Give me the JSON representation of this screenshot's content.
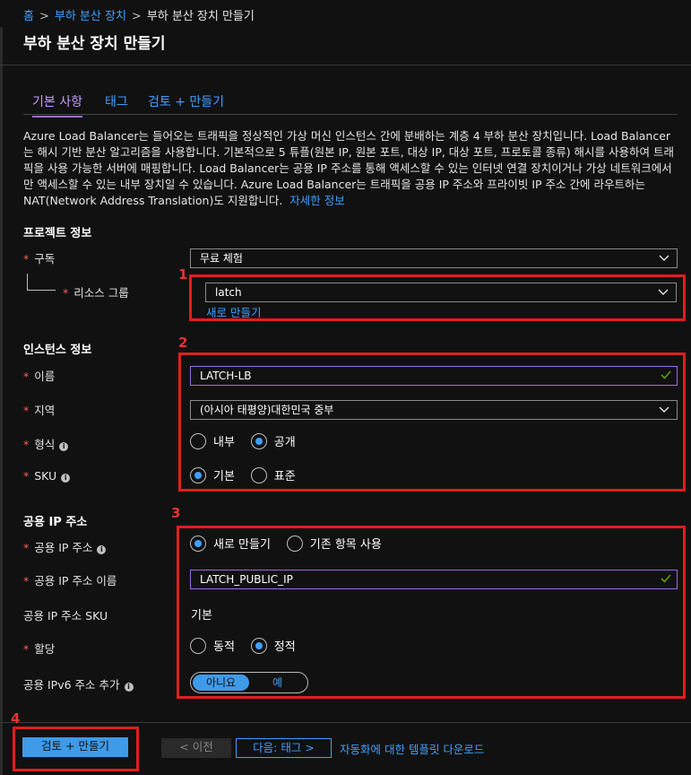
{
  "breadcrumb": {
    "home": "홈",
    "parent": "부하 분산 장치",
    "current": "부하 분산 장치 만들기"
  },
  "page_title": "부하 분산 장치 만들기",
  "tabs": [
    {
      "label": "기본 사항",
      "active": true
    },
    {
      "label": "태그",
      "active": false
    },
    {
      "label": "검토 + 만들기",
      "active": false
    }
  ],
  "description": {
    "text": "Azure Load Balancer는 들어오는 트래픽을 정상적인 가상 머신 인스턴스 간에 분배하는 계층 4 부하 분산 장치입니다. Load Balancer는 해시 기반 분산 알고리즘을 사용합니다. 기본적으로 5 튜플(원본 IP, 원본 포트, 대상 IP, 대상 포트, 프로토콜 종류) 해시를 사용하여 트래픽을 사용 가능한 서버에 매핑합니다. Load Balancer는 공용 IP 주소를 통해 액세스할 수 있는 인터넷 연결 장치이거나 가상 네트워크에서만 액세스할 수 있는 내부 장치일 수 있습니다. Azure Load Balancer는 트래픽을 공용 IP 주소와 프라이빗 IP 주소 간에 라우트하는 NAT(Network Address Translation)도 지원합니다.",
    "learn_more": "자세한 정보"
  },
  "project": {
    "heading": "프로젝트 정보",
    "subscription_label": "구독",
    "subscription_value": "무료 체험",
    "rg_label": "리소스 그룹",
    "rg_value": "latch",
    "rg_create_new": "새로 만들기"
  },
  "instance": {
    "heading": "인스턴스 정보",
    "name_label": "이름",
    "name_value": "LATCH-LB",
    "region_label": "지역",
    "region_value": "(아시아 태평양)대한민국 중부",
    "type_label": "형식",
    "type_options": [
      "내부",
      "공개"
    ],
    "type_selected": "공개",
    "sku_label": "SKU",
    "sku_options": [
      "기본",
      "표준"
    ],
    "sku_selected": "기본"
  },
  "public_ip": {
    "heading": "공용 IP 주소",
    "ip_label": "공용 IP 주소",
    "ip_options": [
      "새로 만들기",
      "기존 항목 사용"
    ],
    "ip_selected": "새로 만들기",
    "name_label": "공용 IP 주소 이름",
    "name_value": "LATCH_PUBLIC_IP",
    "sku_label": "공용 IP 주소 SKU",
    "sku_value": "기본",
    "assign_label": "할당",
    "assign_options": [
      "동적",
      "정적"
    ],
    "assign_selected": "정적",
    "ipv6_label": "공용 IPv6 주소 추가",
    "ipv6_options": [
      "아니요",
      "예"
    ],
    "ipv6_selected": "아니요"
  },
  "annotations": [
    "1",
    "2",
    "3",
    "4"
  ],
  "footer": {
    "review_create": "검토 + 만들기",
    "previous": "< 이전",
    "next": "다음: 태그 >",
    "download_template": "자동화에 대한 템플릿 다운로드"
  },
  "colors": {
    "accent": "#3f9ae8",
    "annotation_red": "#e01e1e",
    "active_tab": "#a06ae8",
    "valid_check": "#57a300"
  }
}
